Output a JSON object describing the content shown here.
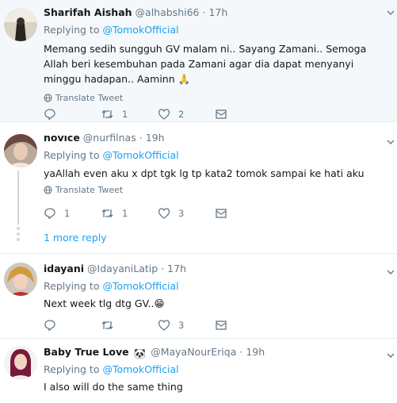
{
  "tweets": [
    {
      "fullname": "Sharifah Aishah",
      "username": "@alhabshi66",
      "sep": "·",
      "time": "17h",
      "replying_label": "Replying to",
      "replying_to": "@TomokOfficial",
      "text": "Memang sedih sungguh GV malam ni.. Sayang Zamani.. Semoga Allah beri kesembuhan pada Zamani agar dia dapat menyanyi minggu hadapan.. Aaminn 🙏",
      "translate_label": "Translate Tweet",
      "actions": {
        "reply_count": "",
        "retweet_count": "1",
        "like_count": "2"
      }
    },
    {
      "fullname": "novıce",
      "username": "@nurfilnas",
      "sep": "·",
      "time": "19h",
      "replying_label": "Replying to",
      "replying_to": "@TomokOfficial",
      "text": "yaAllah even aku x dpt tgk lg tp kata2 tomok sampai ke hati aku",
      "translate_label": "Translate Tweet",
      "actions": {
        "reply_count": "1",
        "retweet_count": "1",
        "like_count": "3"
      },
      "more_replies_label": "1 more reply"
    },
    {
      "fullname": "idayani",
      "username": "@IdayaniLatip",
      "sep": "·",
      "time": "17h",
      "replying_label": "Replying to",
      "replying_to": "@TomokOfficial",
      "text": "Next week tlg dtg GV..😁",
      "actions": {
        "reply_count": "",
        "retweet_count": "",
        "like_count": "3"
      }
    },
    {
      "fullname": "Baby True Love",
      "fullname_emoji": "🐼",
      "username": "@MayaNourEriqa",
      "sep": "·",
      "time": "19h",
      "replying_label": "Replying to",
      "replying_to": "@TomokOfficial",
      "text": "I also will do the same thing"
    }
  ],
  "icons": {
    "reply": "reply-icon",
    "retweet": "retweet-icon",
    "like": "heart-icon",
    "dm": "envelope-icon",
    "more": "chevron-down-icon",
    "translate": "globe-icon"
  },
  "colors": {
    "link": "#1da1f2",
    "secondary_text": "#657786",
    "highlight_bg": "#f5f8fa",
    "divider": "#e6ecf0",
    "thread_line": "#ccd6dd"
  }
}
